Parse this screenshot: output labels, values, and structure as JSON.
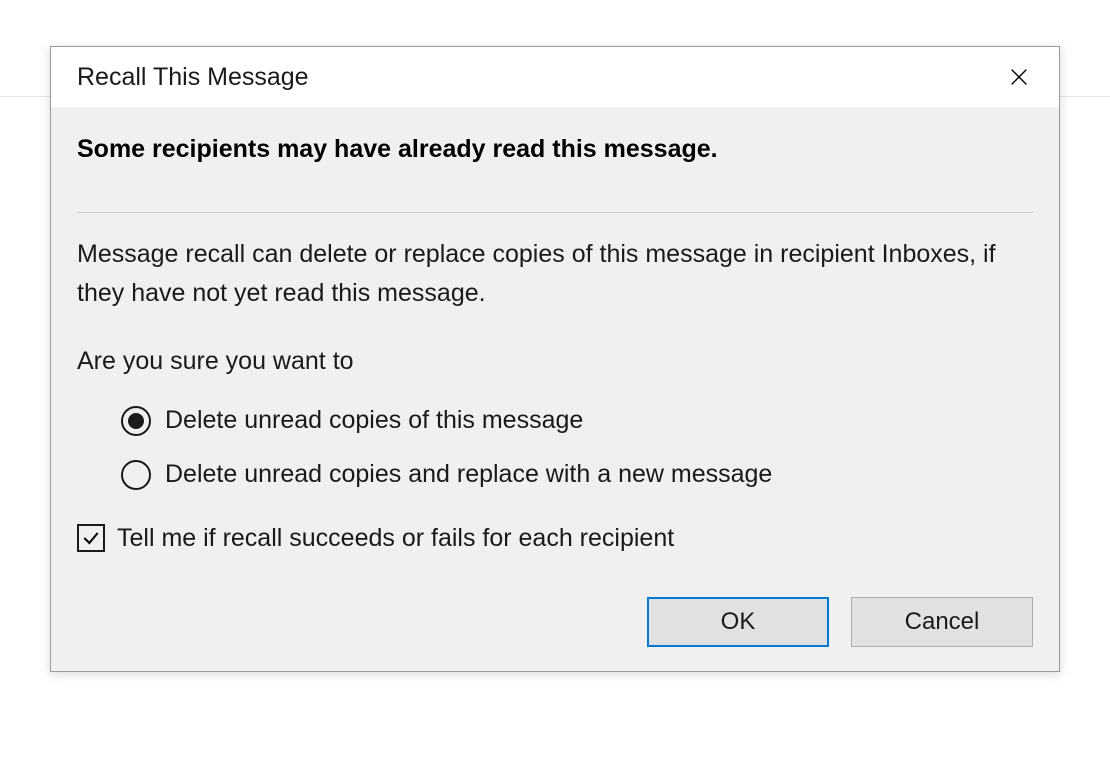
{
  "dialog": {
    "title": "Recall This Message",
    "warning": "Some recipients may have already read this message.",
    "description": "Message recall can delete or replace copies of this message in recipient Inboxes, if they have not yet read this message.",
    "prompt": "Are you sure you want to",
    "options": {
      "delete": "Delete unread copies of this message",
      "replace": "Delete unread copies and replace with a new message"
    },
    "checkbox_label": "Tell me if recall succeeds or fails for each recipient",
    "buttons": {
      "ok": "OK",
      "cancel": "Cancel"
    },
    "state": {
      "selected_option": "delete",
      "notify_checked": true
    }
  }
}
